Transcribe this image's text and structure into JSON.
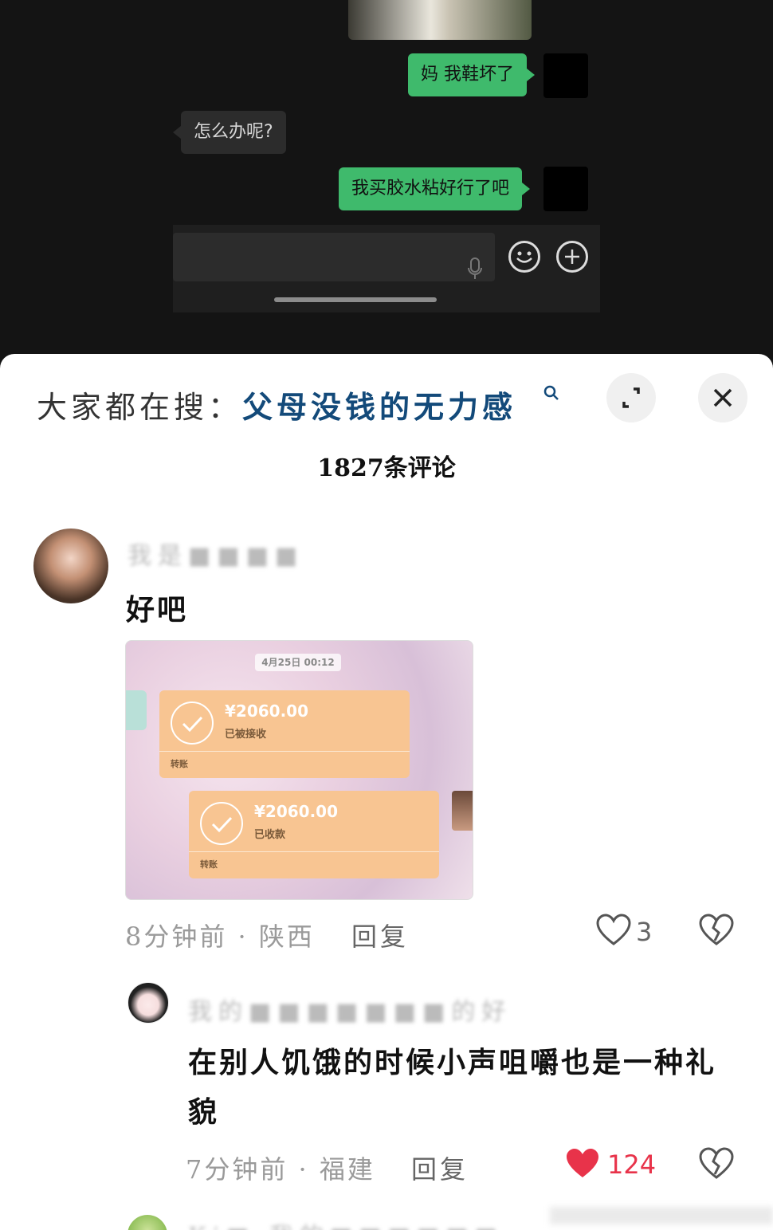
{
  "chat": {
    "messages": [
      {
        "side": "me",
        "text": "妈 我鞋坏了"
      },
      {
        "side": "other",
        "text": "怎么办呢?"
      },
      {
        "side": "me",
        "text": "我买胶水粘好行了吧"
      }
    ],
    "icons": {
      "voice": "microphone-icon",
      "emoji": "smile-icon",
      "more": "plus-circle-icon"
    }
  },
  "sheet": {
    "search_prefix": "大家都在搜：",
    "search_term": "父母没钱的无力感",
    "comment_count": "1827条评论",
    "comments": [
      {
        "author": "我是■■■■",
        "text": "好吧",
        "image": {
          "time": "4月25日  00:12",
          "cards": [
            {
              "amount": "¥2060.00",
              "status": "已被接收",
              "label": "转账"
            },
            {
              "amount": "¥2060.00",
              "status": "已收款",
              "label": "转账"
            }
          ]
        },
        "time": "8分钟前 · 陕西",
        "reply": "回复",
        "likes": "3",
        "liked": false
      },
      {
        "author": "我的■■■■■■■的好",
        "text": "在别人饥饿的时候小声咀嚼也是一种礼貌",
        "time": "7分钟前 · 福建",
        "reply": "回复",
        "likes": "124",
        "liked": true
      }
    ],
    "next_author": "Ki■ 我的■■■■■■"
  },
  "colors": {
    "bubble_me": "#3fba6c",
    "search_term": "#134a7a",
    "like_active": "#e8334a"
  }
}
